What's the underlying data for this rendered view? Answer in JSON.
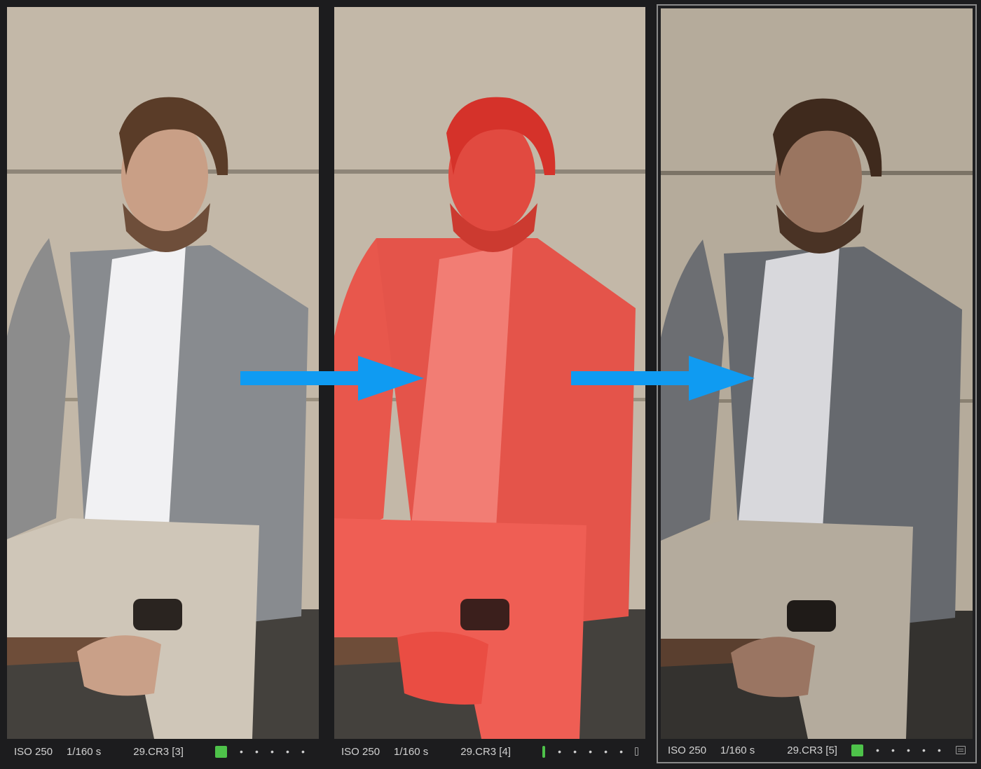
{
  "grid": {
    "cells": [
      {
        "iso": "ISO 250",
        "shutter": "1/160 s",
        "file": "29.CR3 [3]",
        "color_label": "#4ec24a",
        "rating_dots": [
          "•",
          "•",
          "•",
          "•",
          "•"
        ],
        "selected": false,
        "tint": "none"
      },
      {
        "iso": "ISO 250",
        "shutter": "1/160 s",
        "file": "29.CR3 [4]",
        "color_label": "#4ec24a",
        "rating_dots": [
          "•",
          "•",
          "•",
          "•",
          "•"
        ],
        "selected": false,
        "tint": "red-mask"
      },
      {
        "iso": "ISO 250",
        "shutter": "1/160 s",
        "file": "29.CR3 [5]",
        "color_label": "#4ec24a",
        "rating_dots": [
          "•",
          "•",
          "•",
          "•",
          "•"
        ],
        "selected": true,
        "tint": "darker"
      }
    ]
  },
  "annotations": {
    "arrow_color": "#0f9bf2",
    "arrow_icon": "arrow-right-icon"
  },
  "colors": {
    "background": "#1c1c1e",
    "mask_red": "#f04a3e"
  }
}
